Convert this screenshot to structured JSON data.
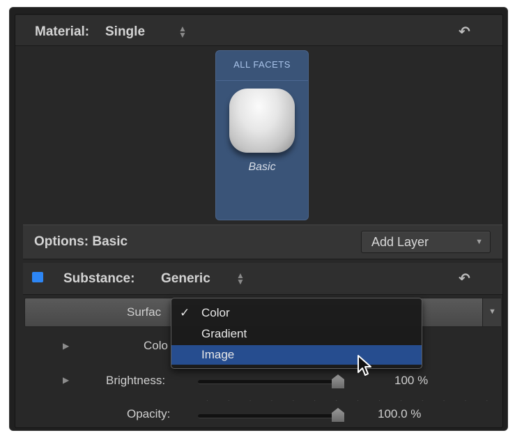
{
  "material": {
    "label": "Material:",
    "value": "Single"
  },
  "facets": {
    "title": "ALL FACETS",
    "name": "Basic"
  },
  "options": {
    "label": "Options: Basic",
    "add_layer_label": "Add Layer"
  },
  "substance": {
    "label": "Substance:",
    "value": "Generic"
  },
  "surface": {
    "label": "Surfac"
  },
  "dropdown": {
    "items": [
      {
        "label": "Color",
        "checked": true,
        "highlighted": false
      },
      {
        "label": "Gradient",
        "checked": false,
        "highlighted": false
      },
      {
        "label": "Image",
        "checked": false,
        "highlighted": true
      }
    ]
  },
  "params": {
    "color": {
      "label": "Colo"
    },
    "brightness": {
      "label": "Brightness:",
      "value": "100 %",
      "level": 1.0
    },
    "opacity": {
      "label": "Opacity:",
      "value": "100.0 %",
      "level": 1.0
    }
  },
  "colors": {
    "accent_blue": "#2d86f5",
    "facet_card": "#3a5478",
    "menu_highlight": "#264d8f"
  },
  "icons": {
    "reset": "reset-arrow-icon",
    "stepper": "updown-stepper-icon",
    "disclosure": "disclosure-triangle-icon",
    "checkmark": "checkmark-icon",
    "cursor": "mouse-pointer-icon"
  }
}
